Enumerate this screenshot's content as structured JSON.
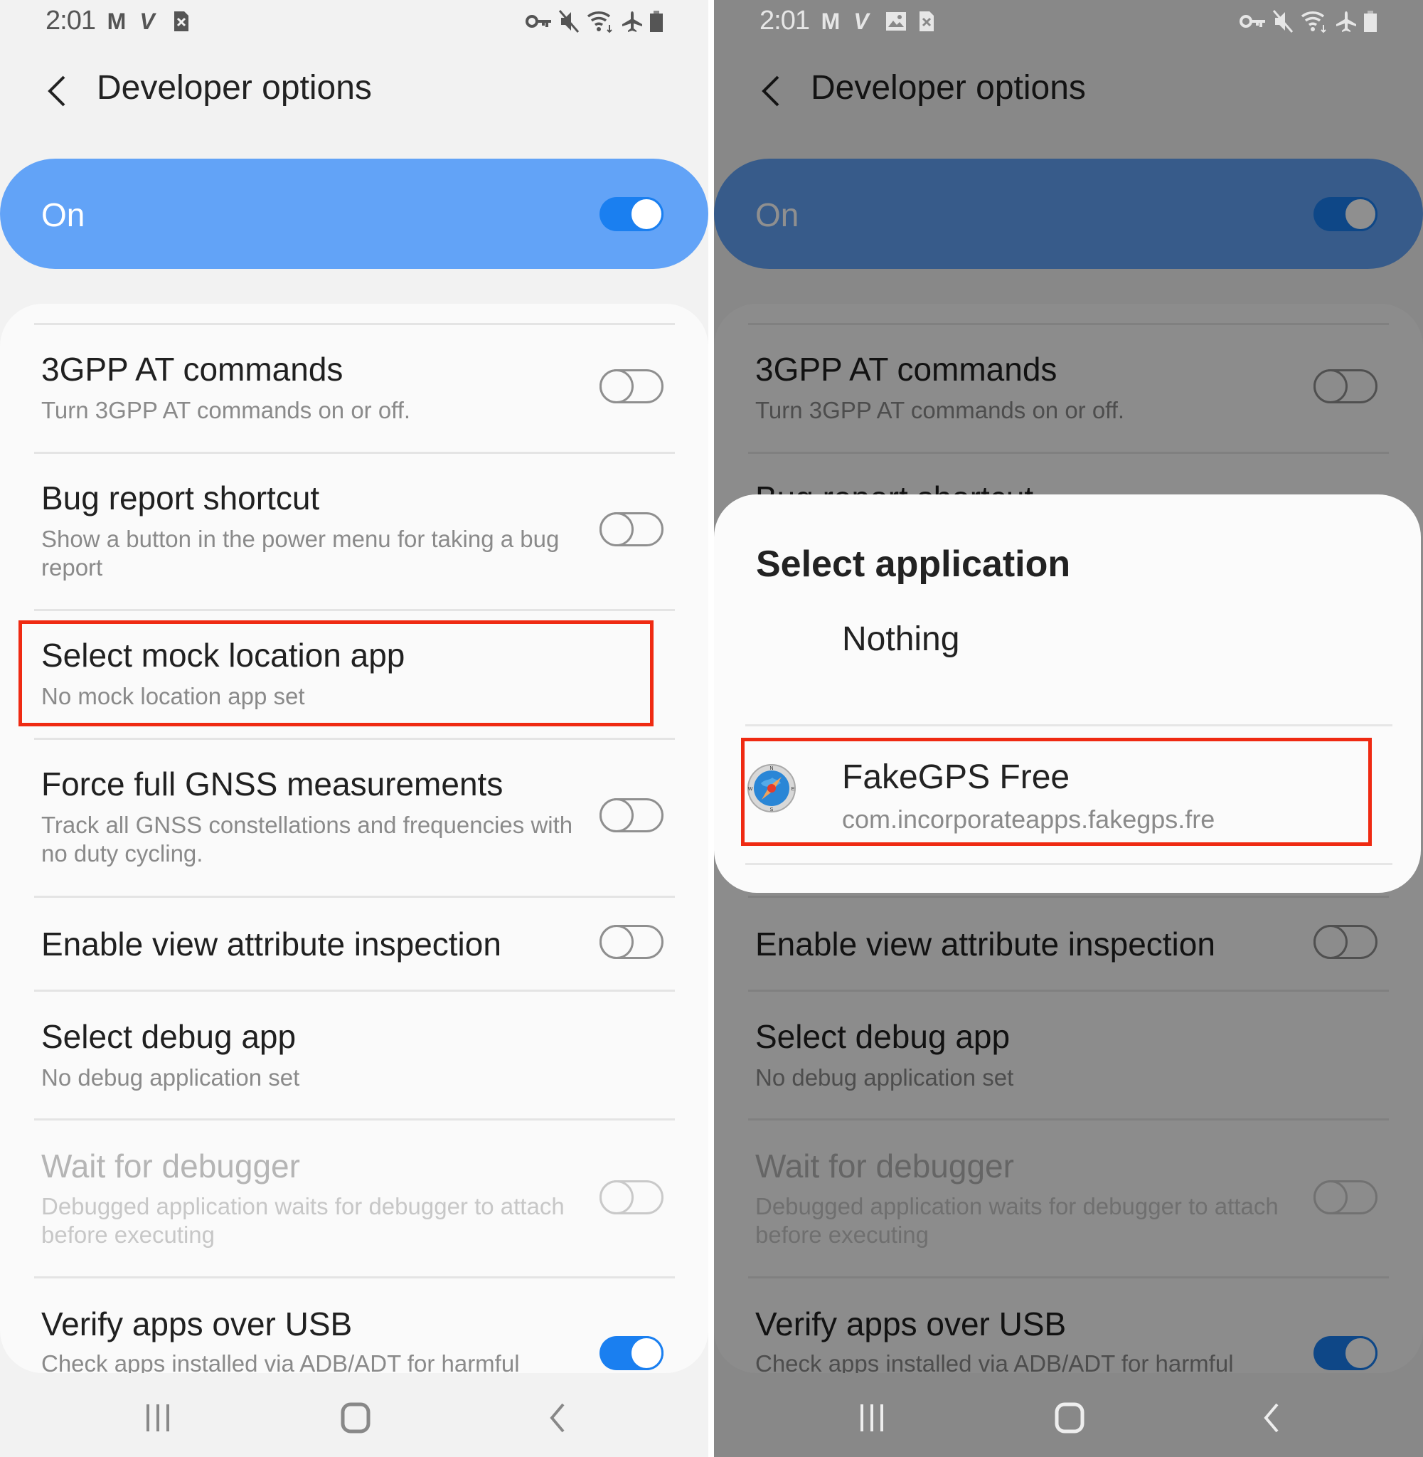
{
  "status_bar": {
    "time": "2:01",
    "left_icons_left_panel": [
      "gmail-icon",
      "v-app-icon",
      "sim-x-icon"
    ],
    "left_icons_right_panel": [
      "gmail-icon",
      "v-app-icon",
      "image-icon",
      "sim-x-icon"
    ],
    "right_icons": [
      "vpn-key-icon",
      "mute-icon",
      "wifi-icon",
      "airplane-icon",
      "battery-icon"
    ]
  },
  "header": {
    "title": "Developer options"
  },
  "master_switch": {
    "label": "On",
    "checked": true
  },
  "settings": [
    {
      "title": "3GPP AT commands",
      "subtitle": "Turn 3GPP AT commands on or off.",
      "toggle": "off",
      "enabled": true
    },
    {
      "title": "Bug report shortcut",
      "subtitle": "Show a button in the power menu for taking a bug report",
      "toggle": "off",
      "enabled": true
    },
    {
      "title": "Select mock location app",
      "subtitle": "No mock location app set",
      "toggle": null,
      "enabled": true,
      "highlighted": true
    },
    {
      "title": "Force full GNSS measurements",
      "subtitle": "Track all GNSS constellations and frequencies with no duty cycling.",
      "toggle": "off",
      "enabled": true
    },
    {
      "title": "Enable view attribute inspection",
      "subtitle": "",
      "toggle": "off",
      "enabled": true
    },
    {
      "title": "Select debug app",
      "subtitle": "No debug application set",
      "toggle": null,
      "enabled": true
    },
    {
      "title": "Wait for debugger",
      "subtitle": "Debugged application waits for debugger to attach before executing",
      "toggle": "off",
      "enabled": false
    },
    {
      "title": "Verify apps over USB",
      "subtitle": "Check apps installed via ADB/ADT for harmful",
      "toggle": "on",
      "enabled": true
    }
  ],
  "dialog": {
    "title": "Select application",
    "options": [
      {
        "label": "Nothing",
        "package": "",
        "icon": null
      },
      {
        "label": "FakeGPS Free",
        "package": "com.incorporateapps.fakegps.fre",
        "icon": "compass-app-icon",
        "highlighted": true
      }
    ]
  },
  "nav_bar": {
    "buttons": [
      "recents",
      "home",
      "back"
    ]
  },
  "colors": {
    "accent": "#1a7ff0",
    "master_bar": "#62a3f7",
    "highlight_box": "#ef2a12",
    "background": "#f2f2f2"
  }
}
